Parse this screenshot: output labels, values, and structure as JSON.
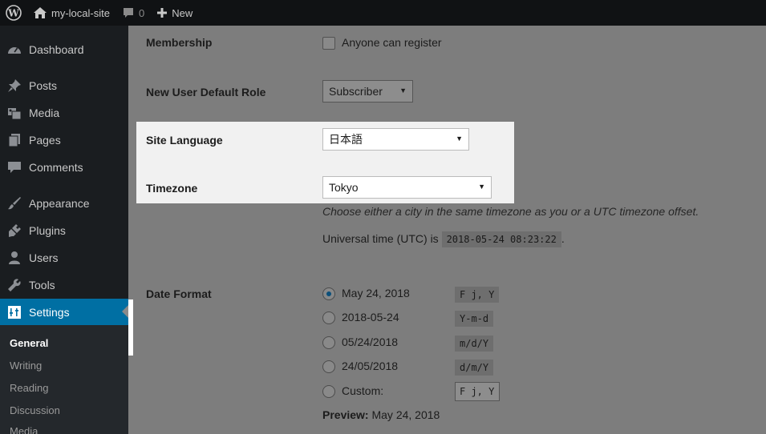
{
  "adminbar": {
    "site_name": "my-local-site",
    "comment_count": "0",
    "new_label": "New"
  },
  "sidebar": {
    "items": [
      {
        "label": "Dashboard",
        "icon": "dashboard-icon"
      },
      {
        "label": "Posts",
        "icon": "pin-icon"
      },
      {
        "label": "Media",
        "icon": "media-icon"
      },
      {
        "label": "Pages",
        "icon": "pages-icon"
      },
      {
        "label": "Comments",
        "icon": "comment-icon"
      },
      {
        "label": "Appearance",
        "icon": "brush-icon"
      },
      {
        "label": "Plugins",
        "icon": "plug-icon"
      },
      {
        "label": "Users",
        "icon": "user-icon"
      },
      {
        "label": "Tools",
        "icon": "wrench-icon"
      },
      {
        "label": "Settings",
        "icon": "settings-icon"
      }
    ],
    "submenu": [
      "General",
      "Writing",
      "Reading",
      "Discussion",
      "Media"
    ]
  },
  "settings": {
    "membership_label": "Membership",
    "membership_checkbox": "Anyone can register",
    "default_role_label": "New User Default Role",
    "default_role_value": "Subscriber",
    "site_language_label": "Site Language",
    "site_language_value": "日本語",
    "timezone_label": "Timezone",
    "timezone_value": "Tokyo",
    "timezone_desc": "Choose either a city in the same timezone as you or a UTC timezone offset.",
    "utc_prefix": "Universal time (UTC) is",
    "utc_value": "2018-05-24 08:23:22",
    "utc_suffix": ".",
    "date_format_label": "Date Format",
    "date_formats": [
      {
        "label": "May 24, 2018",
        "code": "F j, Y"
      },
      {
        "label": "2018-05-24",
        "code": "Y-m-d"
      },
      {
        "label": "05/24/2018",
        "code": "m/d/Y"
      },
      {
        "label": "24/05/2018",
        "code": "d/m/Y"
      }
    ],
    "custom_label": "Custom:",
    "custom_value": "F j, Y",
    "preview_label": "Preview:",
    "preview_value": "May 24, 2018"
  },
  "colors": {
    "accent": "#0073aa",
    "overlay": "#7d7d7d",
    "highlight": "#f1f1f1"
  }
}
